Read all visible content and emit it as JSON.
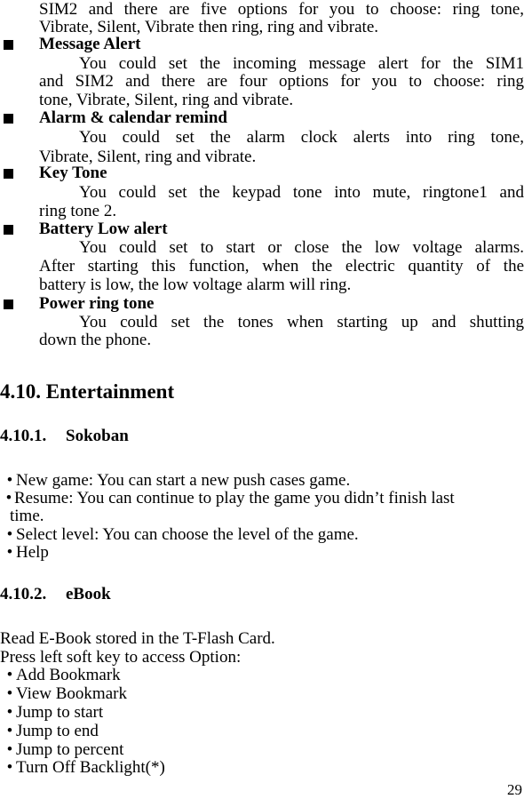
{
  "page_number": "29",
  "ringtone_continuation": {
    "lines": [
      "SIM2 and there are five options for you to choose: ring tone,",
      "Vibrate, Silent, Vibrate then ring, ring and vibrate."
    ]
  },
  "settings_items": [
    {
      "title": "Message Alert",
      "lines": [
        "You could set the incoming message alert for the SIM1",
        "and SIM2 and there are four options for you to choose: ring",
        "tone, Vibrate, Silent, ring and vibrate."
      ]
    },
    {
      "title": "Alarm & calendar remind",
      "lines": [
        "You could set the alarm clock alerts into ring tone,",
        "Vibrate, Silent, ring and vibrate."
      ]
    },
    {
      "title": "Key Tone",
      "lines": [
        "You could set the keypad tone into mute, ringtone1 and",
        "ring tone 2."
      ]
    },
    {
      "title": "Battery Low alert",
      "lines": [
        "You could set to start or close the low voltage alarms.",
        "After starting this function, when the electric quantity of the",
        "battery is low, the low voltage alarm will ring."
      ]
    },
    {
      "title": "Power ring tone",
      "lines": [
        "You could set the tones when starting up and shutting",
        "down the phone."
      ]
    }
  ],
  "section": {
    "heading": "4.10. Entertainment",
    "sokoban": {
      "number": "4.10.1.",
      "title": "Sokoban",
      "bullet": "•",
      "items": [
        "New game: You can start a new push cases game.",
        "Resume: You can continue to play the game you didn’t finish last",
        "time.",
        "Select level: You can choose the level of the game.",
        "Help"
      ]
    },
    "ebook": {
      "number": "4.10.2.",
      "title": "eBook",
      "intro": [
        "Read E-Book stored in the T-Flash Card.",
        "Press left soft key to access Option:"
      ],
      "bullet": "•",
      "options": [
        "Add Bookmark",
        "View Bookmark",
        "Jump to start",
        "Jump to end",
        "Jump to percent",
        "Turn Off Backlight(*)"
      ]
    }
  }
}
